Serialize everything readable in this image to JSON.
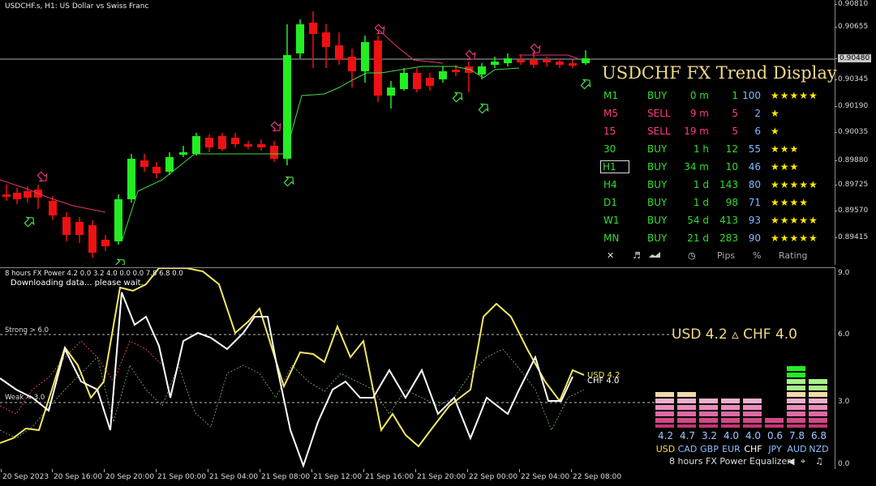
{
  "chart": {
    "title": "USDCHF.s, H1:  US Dollar vs Swiss Franc",
    "price_ticks": [
      "0.90810",
      "0.90655",
      "0.90480",
      "0.90345",
      "0.90190",
      "0.90035",
      "0.89880",
      "0.89725",
      "0.89570",
      "0.89415"
    ],
    "current_price": "0.90480",
    "time_labels": [
      "20 Sep 2023",
      "20 Sep 16:00",
      "20 Sep 20:00",
      "21 Sep 00:00",
      "21 Sep 04:00",
      "21 Sep 08:00",
      "21 Sep 12:00",
      "21 Sep 16:00",
      "21 Sep 20:00",
      "22 Sep 00:00",
      "22 Sep 04:00",
      "22 Sep 08:00"
    ],
    "colors": {
      "bull": "#22ee22",
      "bear": "#ee1111",
      "trail_up": "#44dd44",
      "trail_down": "#e2357a",
      "stop_line": "#b0b0b0"
    }
  },
  "trend_display": {
    "title": "USDCHF FX Trend Display",
    "rows": [
      {
        "tf": "M1",
        "dir": "BUY",
        "time": "0 m",
        "pips": "1",
        "rate": "100",
        "stars": "★★★★★",
        "color": "#33dd33"
      },
      {
        "tf": "M5",
        "dir": "SELL",
        "time": "9 m",
        "pips": "5",
        "rate": "2",
        "stars": "★",
        "color": "#ff3b86"
      },
      {
        "tf": "15",
        "dir": "SELL",
        "time": "19 m",
        "pips": "5",
        "rate": "6",
        "stars": "★",
        "color": "#ff3b86"
      },
      {
        "tf": "30",
        "dir": "BUY",
        "time": "1 h",
        "pips": "12",
        "rate": "55",
        "stars": "★★★",
        "color": "#33dd33"
      },
      {
        "tf": "H1",
        "dir": "BUY",
        "time": "34 m",
        "pips": "10",
        "rate": "46",
        "stars": "★★★",
        "color": "#33dd33"
      },
      {
        "tf": "H4",
        "dir": "BUY",
        "time": "1 d",
        "pips": "143",
        "rate": "80",
        "stars": "★★★★★",
        "color": "#33dd33"
      },
      {
        "tf": "D1",
        "dir": "BUY",
        "time": "1 d",
        "pips": "98",
        "rate": "71",
        "stars": "★★★★",
        "color": "#33dd33"
      },
      {
        "tf": "W1",
        "dir": "BUY",
        "time": "54 d",
        "pips": "413",
        "rate": "93",
        "stars": "★★★★★",
        "color": "#33dd33"
      },
      {
        "tf": "MN",
        "dir": "BUY",
        "time": "21 d",
        "pips": "283",
        "rate": "90",
        "stars": "★★★★★",
        "color": "#33dd33"
      }
    ],
    "footer": {
      "close": "✕",
      "sound": "♬",
      "clock": "◷",
      "pips": "Pips",
      "percent": "%",
      "rating": "Rating"
    }
  },
  "indicator": {
    "title": "8 hours FX Power 4.2 0.0 3.2 4.0 0.0 0.0 7.8 6.8 0.0",
    "status": "Downloading data... please wait.",
    "strong_label": "Strong > 6.0",
    "weak_label": "Weak < 3.0",
    "scale_ticks": [
      "9.0",
      "6.0",
      "3.0",
      "0.0"
    ],
    "line_label_1": "USD 4.2",
    "line_label_2": "CHF 4.0",
    "usd_color": "#f5e663",
    "chf_color": "#ffffff",
    "power_headline": "USD 4.2  ▵  CHF 4.0",
    "equalizer": {
      "values": [
        "4.2",
        "4.7",
        "3.2",
        "4.0",
        "4.0",
        "0.6",
        "7.8",
        "6.8"
      ],
      "currencies": [
        "USD",
        "CAD",
        "GBP",
        "EUR",
        "CHF",
        "JPY",
        "AUD",
        "NZD"
      ],
      "levels": [
        4.2,
        4.7,
        3.2,
        4.0,
        4.0,
        0.6,
        7.8,
        6.8
      ],
      "footer_period": "8 hours",
      "footer_name": "FX Power",
      "footer_eq": "Equalizer",
      "footer_icons": [
        "◀",
        "⌖",
        "♫"
      ]
    }
  }
}
